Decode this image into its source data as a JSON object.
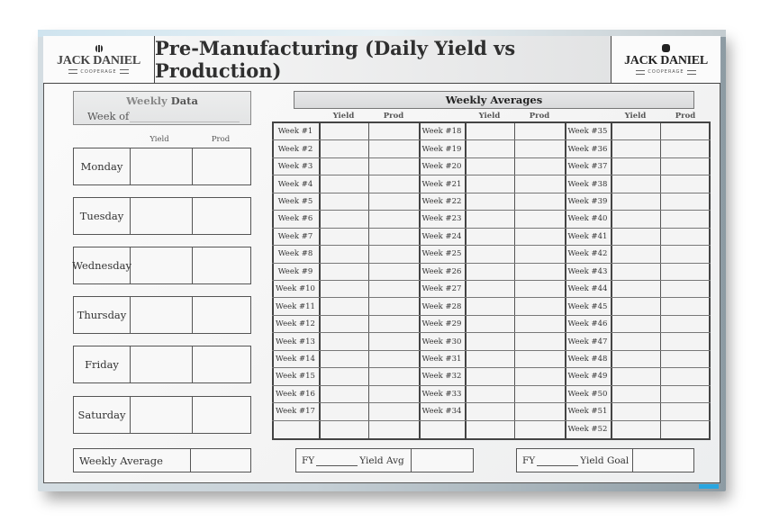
{
  "header": {
    "title": "Pre-Manufacturing (Daily Yield vs Production)",
    "logo_left": {
      "name": "JACK DANIEL",
      "sub": "COOPERAGE",
      "icon": "barrel-icon"
    },
    "logo_right": {
      "name": "JACK DANIEL",
      "sub": "COOPERAGE",
      "icon": "barrel-icon"
    }
  },
  "weekly_data": {
    "title_light": "Weekly",
    "title_bold": "Data",
    "week_of_label": "Week of",
    "week_of_value": "",
    "col_yield": "Yield",
    "col_prod": "Prod",
    "days": [
      {
        "label": "Monday",
        "yield": "",
        "prod": ""
      },
      {
        "label": "Tuesday",
        "yield": "",
        "prod": ""
      },
      {
        "label": "Wednesday",
        "yield": "",
        "prod": ""
      },
      {
        "label": "Thursday",
        "yield": "",
        "prod": ""
      },
      {
        "label": "Friday",
        "yield": "",
        "prod": ""
      },
      {
        "label": "Saturday",
        "yield": "",
        "prod": ""
      }
    ],
    "weekly_average_label": "Weekly Average",
    "weekly_average_value": ""
  },
  "weekly_averages": {
    "title": "Weekly Averages",
    "col_yield": "Yield",
    "col_prod": "Prod",
    "columns": [
      [
        "Week #1",
        "Week #2",
        "Week #3",
        "Week #4",
        "Week #5",
        "Week #6",
        "Week #7",
        "Week #8",
        "Week #9",
        "Week #10",
        "Week #11",
        "Week #12",
        "Week #13",
        "Week #14",
        "Week #15",
        "Week #16",
        "Week #17",
        ""
      ],
      [
        "Week #18",
        "Week #19",
        "Week #20",
        "Week #21",
        "Week #22",
        "Week #23",
        "Week #24",
        "Week #25",
        "Week #26",
        "Week #27",
        "Week #28",
        "Week #29",
        "Week #30",
        "Week #31",
        "Week #32",
        "Week #33",
        "Week #34",
        ""
      ],
      [
        "Week #35",
        "Week #36",
        "Week #37",
        "Week #38",
        "Week #39",
        "Week #40",
        "Week #41",
        "Week #42",
        "Week #43",
        "Week #44",
        "Week #45",
        "Week #46",
        "Week #47",
        "Week #48",
        "Week #49",
        "Week #50",
        "Week #51",
        "Week #52"
      ]
    ]
  },
  "footer": {
    "fy_prefix": "FY",
    "yield_avg_label": "Yield Avg",
    "yield_avg_value": "",
    "yield_goal_label": "Yield Goal",
    "yield_goal_value": ""
  },
  "colors": {
    "frame": "#8d9ba3",
    "brand_tag": "#29a6e0",
    "board": "#f4f4f4"
  }
}
